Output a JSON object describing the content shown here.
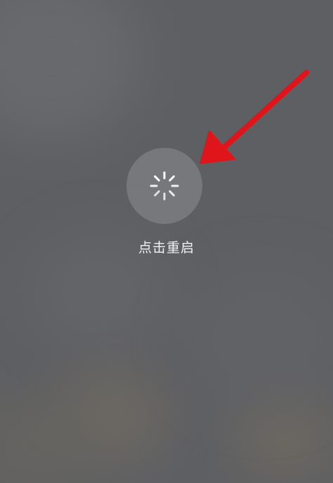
{
  "restart": {
    "label": "点击重启",
    "icon": "loading-spinner-icon"
  },
  "annotation": {
    "icon": "red-arrow-icon",
    "color": "#e0141b"
  },
  "colors": {
    "background": "#5e5f63",
    "text": "#f2f2f2"
  }
}
